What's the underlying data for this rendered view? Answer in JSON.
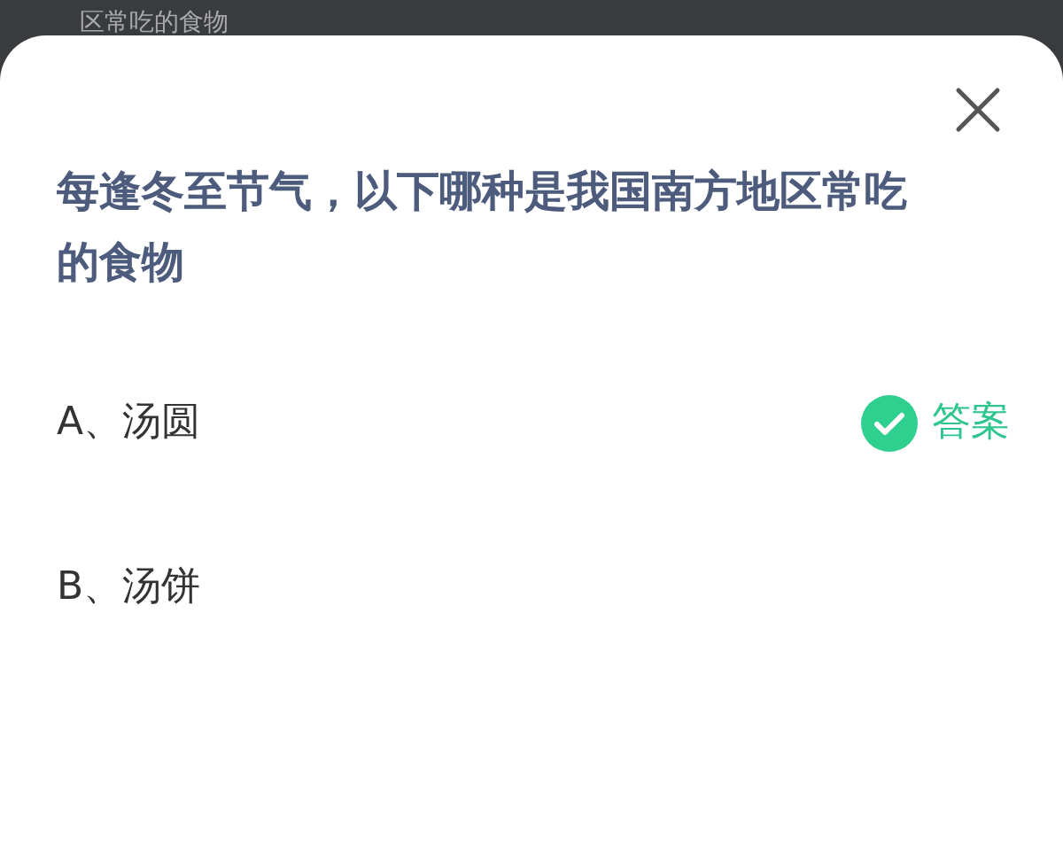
{
  "background_text": "区常吃的食物",
  "question": "每逢冬至节气，以下哪种是我国南方地区常吃的食物",
  "answer_label": "答案",
  "options": [
    {
      "label": "A、汤圆",
      "correct": true
    },
    {
      "label": "B、汤饼",
      "correct": false
    }
  ]
}
